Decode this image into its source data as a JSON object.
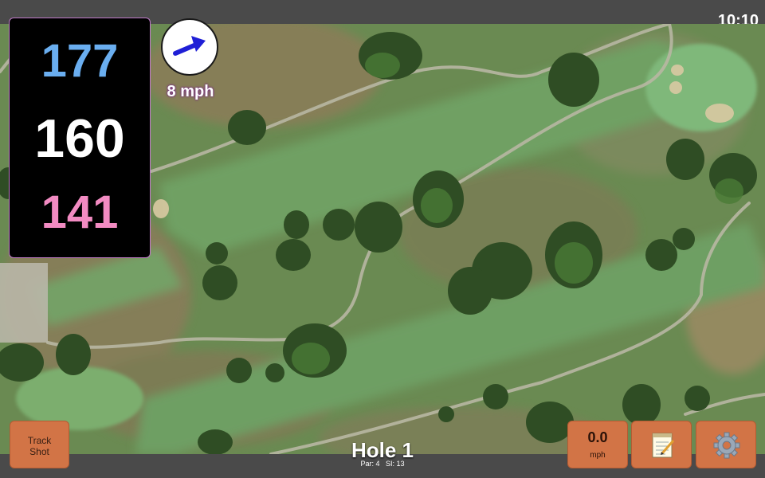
{
  "status_bar": {
    "time": "10:10"
  },
  "yardages": {
    "back": "177",
    "center": "160",
    "front": "141"
  },
  "wind": {
    "speed_label": "8 mph",
    "icon": "wind-direction-arrow-icon"
  },
  "controls": {
    "track_shot_line1": "Track",
    "track_shot_line2": "Shot",
    "speed_value": "0.0",
    "speed_unit": "mph",
    "notes_icon": "notepad-icon",
    "settings_icon": "gear-icon"
  },
  "hole": {
    "title": "Hole 1",
    "par": "Par: 4",
    "si": "SI: 13"
  },
  "colors": {
    "back": "#6aaef0",
    "center": "#ffffff",
    "front": "#f28bc2",
    "button": "#d27446",
    "bar": "#4a4a4a"
  }
}
